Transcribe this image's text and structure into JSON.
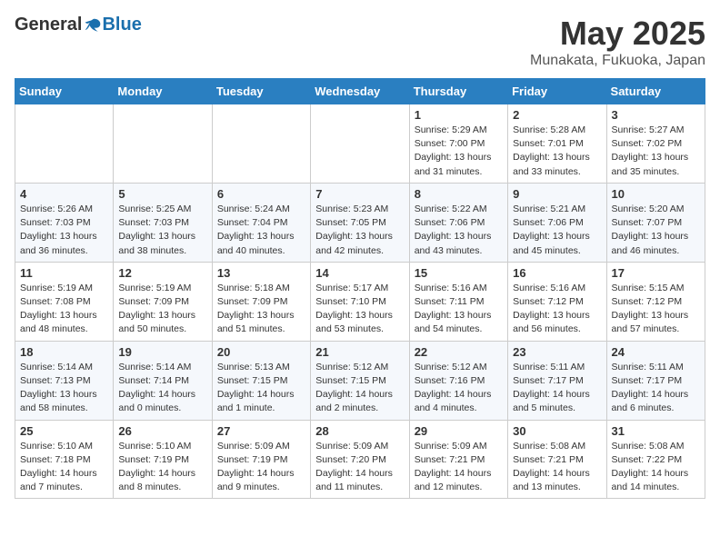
{
  "header": {
    "logo_general": "General",
    "logo_blue": "Blue",
    "title": "May 2025",
    "location": "Munakata, Fukuoka, Japan"
  },
  "calendar": {
    "headers": [
      "Sunday",
      "Monday",
      "Tuesday",
      "Wednesday",
      "Thursday",
      "Friday",
      "Saturday"
    ],
    "weeks": [
      [
        {
          "day": "",
          "info": ""
        },
        {
          "day": "",
          "info": ""
        },
        {
          "day": "",
          "info": ""
        },
        {
          "day": "",
          "info": ""
        },
        {
          "day": "1",
          "info": "Sunrise: 5:29 AM\nSunset: 7:00 PM\nDaylight: 13 hours\nand 31 minutes."
        },
        {
          "day": "2",
          "info": "Sunrise: 5:28 AM\nSunset: 7:01 PM\nDaylight: 13 hours\nand 33 minutes."
        },
        {
          "day": "3",
          "info": "Sunrise: 5:27 AM\nSunset: 7:02 PM\nDaylight: 13 hours\nand 35 minutes."
        }
      ],
      [
        {
          "day": "4",
          "info": "Sunrise: 5:26 AM\nSunset: 7:03 PM\nDaylight: 13 hours\nand 36 minutes."
        },
        {
          "day": "5",
          "info": "Sunrise: 5:25 AM\nSunset: 7:03 PM\nDaylight: 13 hours\nand 38 minutes."
        },
        {
          "day": "6",
          "info": "Sunrise: 5:24 AM\nSunset: 7:04 PM\nDaylight: 13 hours\nand 40 minutes."
        },
        {
          "day": "7",
          "info": "Sunrise: 5:23 AM\nSunset: 7:05 PM\nDaylight: 13 hours\nand 42 minutes."
        },
        {
          "day": "8",
          "info": "Sunrise: 5:22 AM\nSunset: 7:06 PM\nDaylight: 13 hours\nand 43 minutes."
        },
        {
          "day": "9",
          "info": "Sunrise: 5:21 AM\nSunset: 7:06 PM\nDaylight: 13 hours\nand 45 minutes."
        },
        {
          "day": "10",
          "info": "Sunrise: 5:20 AM\nSunset: 7:07 PM\nDaylight: 13 hours\nand 46 minutes."
        }
      ],
      [
        {
          "day": "11",
          "info": "Sunrise: 5:19 AM\nSunset: 7:08 PM\nDaylight: 13 hours\nand 48 minutes."
        },
        {
          "day": "12",
          "info": "Sunrise: 5:19 AM\nSunset: 7:09 PM\nDaylight: 13 hours\nand 50 minutes."
        },
        {
          "day": "13",
          "info": "Sunrise: 5:18 AM\nSunset: 7:09 PM\nDaylight: 13 hours\nand 51 minutes."
        },
        {
          "day": "14",
          "info": "Sunrise: 5:17 AM\nSunset: 7:10 PM\nDaylight: 13 hours\nand 53 minutes."
        },
        {
          "day": "15",
          "info": "Sunrise: 5:16 AM\nSunset: 7:11 PM\nDaylight: 13 hours\nand 54 minutes."
        },
        {
          "day": "16",
          "info": "Sunrise: 5:16 AM\nSunset: 7:12 PM\nDaylight: 13 hours\nand 56 minutes."
        },
        {
          "day": "17",
          "info": "Sunrise: 5:15 AM\nSunset: 7:12 PM\nDaylight: 13 hours\nand 57 minutes."
        }
      ],
      [
        {
          "day": "18",
          "info": "Sunrise: 5:14 AM\nSunset: 7:13 PM\nDaylight: 13 hours\nand 58 minutes."
        },
        {
          "day": "19",
          "info": "Sunrise: 5:14 AM\nSunset: 7:14 PM\nDaylight: 14 hours\nand 0 minutes."
        },
        {
          "day": "20",
          "info": "Sunrise: 5:13 AM\nSunset: 7:15 PM\nDaylight: 14 hours\nand 1 minute."
        },
        {
          "day": "21",
          "info": "Sunrise: 5:12 AM\nSunset: 7:15 PM\nDaylight: 14 hours\nand 2 minutes."
        },
        {
          "day": "22",
          "info": "Sunrise: 5:12 AM\nSunset: 7:16 PM\nDaylight: 14 hours\nand 4 minutes."
        },
        {
          "day": "23",
          "info": "Sunrise: 5:11 AM\nSunset: 7:17 PM\nDaylight: 14 hours\nand 5 minutes."
        },
        {
          "day": "24",
          "info": "Sunrise: 5:11 AM\nSunset: 7:17 PM\nDaylight: 14 hours\nand 6 minutes."
        }
      ],
      [
        {
          "day": "25",
          "info": "Sunrise: 5:10 AM\nSunset: 7:18 PM\nDaylight: 14 hours\nand 7 minutes."
        },
        {
          "day": "26",
          "info": "Sunrise: 5:10 AM\nSunset: 7:19 PM\nDaylight: 14 hours\nand 8 minutes."
        },
        {
          "day": "27",
          "info": "Sunrise: 5:09 AM\nSunset: 7:19 PM\nDaylight: 14 hours\nand 9 minutes."
        },
        {
          "day": "28",
          "info": "Sunrise: 5:09 AM\nSunset: 7:20 PM\nDaylight: 14 hours\nand 11 minutes."
        },
        {
          "day": "29",
          "info": "Sunrise: 5:09 AM\nSunset: 7:21 PM\nDaylight: 14 hours\nand 12 minutes."
        },
        {
          "day": "30",
          "info": "Sunrise: 5:08 AM\nSunset: 7:21 PM\nDaylight: 14 hours\nand 13 minutes."
        },
        {
          "day": "31",
          "info": "Sunrise: 5:08 AM\nSunset: 7:22 PM\nDaylight: 14 hours\nand 14 minutes."
        }
      ]
    ]
  }
}
